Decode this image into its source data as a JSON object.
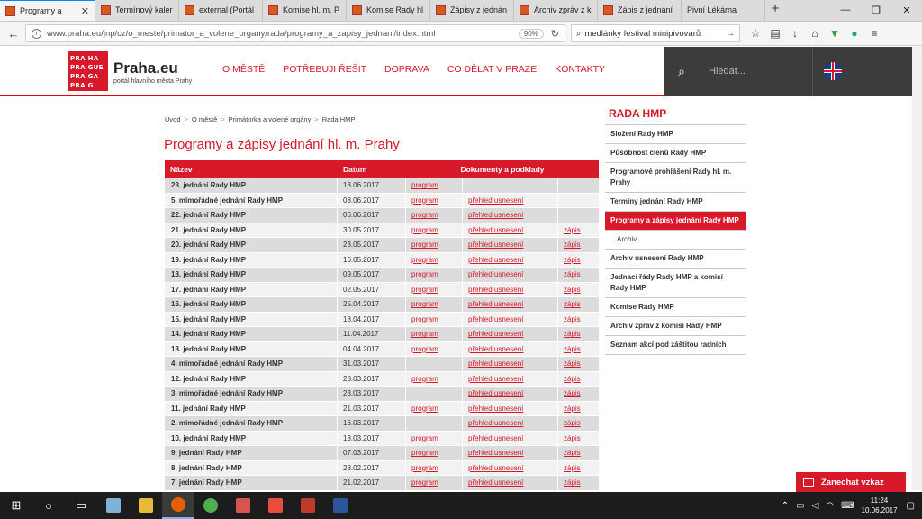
{
  "browser": {
    "tabs": [
      {
        "label": "Programy a",
        "active": true,
        "has_icon": true
      },
      {
        "label": "Termínový kaler",
        "has_icon": true
      },
      {
        "label": "external (Portál",
        "has_icon": true
      },
      {
        "label": "Komise hl. m. P",
        "has_icon": true
      },
      {
        "label": "Komise Rady hl.",
        "has_icon": true
      },
      {
        "label": "Zápisy z jednán",
        "has_icon": true
      },
      {
        "label": "Archiv zpráv z k",
        "has_icon": true
      },
      {
        "label": "Zápis z jednání",
        "has_icon": true
      },
      {
        "label": "Pivní Lékárna",
        "has_icon": false
      }
    ],
    "url": "www.praha.eu/jnp/cz/o_meste/primator_a_volene_organy/rada/programy_a_zapisy_jednani/index.html",
    "zoom": "90%",
    "search_value": "medlánky festival minipivovarů"
  },
  "site": {
    "logo_lines": [
      "PRA HA",
      "PRA GUE",
      "PRA GA",
      "PRA G"
    ],
    "brand_name": "Praha.eu",
    "brand_tagline": "portál hlavního města Prahy",
    "nav": [
      "O MĚSTĚ",
      "POTŘEBUJI ŘEŠIT",
      "DOPRAVA",
      "CO DĚLAT V PRAZE",
      "KONTAKTY"
    ],
    "search_placeholder": "Hledat..."
  },
  "breadcrumb": [
    "Úvod",
    "O městě",
    "Primátorka a volené orgány",
    "Rada HMP"
  ],
  "page_title": "Programy a zápisy jednání hl. m. Prahy",
  "table": {
    "headers": {
      "name": "Název",
      "date": "Datum",
      "docs": "Dokumenty a podklady"
    },
    "rows": [
      {
        "name": "23. jednání Rady HMP",
        "date": "13.06.2017",
        "program": "program",
        "usneseni": "",
        "zapis": ""
      },
      {
        "name": "5. mimořádné jednání Rady HMP",
        "date": "08.06.2017",
        "program": "program",
        "usneseni": "přehled usnesení",
        "zapis": ""
      },
      {
        "name": "22. jednání Rady HMP",
        "date": "06.06.2017",
        "program": "program",
        "usneseni": "přehled usnesení",
        "zapis": ""
      },
      {
        "name": "21. jednání Rady HMP",
        "date": "30.05.2017",
        "program": "program",
        "usneseni": "přehled usnesení",
        "zapis": "zápis"
      },
      {
        "name": "20. jednání Rady HMP",
        "date": "23.05.2017",
        "program": "program",
        "usneseni": "přehled usnesení",
        "zapis": "zápis"
      },
      {
        "name": "19. jednání Rady HMP",
        "date": "16.05.2017",
        "program": "program",
        "usneseni": "přehled usnesení",
        "zapis": "zápis"
      },
      {
        "name": "18. jednání Rady HMP",
        "date": "09.05.2017",
        "program": "program",
        "usneseni": "přehled usnesení",
        "zapis": "zápis"
      },
      {
        "name": "17. jednání Rady HMP",
        "date": "02.05.2017",
        "program": "program",
        "usneseni": "přehled usnesení",
        "zapis": "zápis"
      },
      {
        "name": "16. jednání Rady HMP",
        "date": "25.04.2017",
        "program": "program",
        "usneseni": "přehled usnesení",
        "zapis": "zápis"
      },
      {
        "name": "15. jednání Rady HMP",
        "date": "18.04.2017",
        "program": "program",
        "usneseni": "přehled usnesení",
        "zapis": "zápis"
      },
      {
        "name": "14. jednání Rady HMP",
        "date": "11.04.2017",
        "program": "program",
        "usneseni": "přehled usnesení",
        "zapis": "zápis"
      },
      {
        "name": "13. jednání Rady HMP",
        "date": "04.04.2017",
        "program": "program",
        "usneseni": "přehled usnesení",
        "zapis": "zápis"
      },
      {
        "name": "4. mimořádné jednání Rady HMP",
        "date": "31.03.2017",
        "program": "",
        "usneseni": "přehled usnesení",
        "zapis": "zápis"
      },
      {
        "name": "12. jednání Rady HMP",
        "date": "28.03.2017",
        "program": "program",
        "usneseni": "přehled usnesení",
        "zapis": "zápis"
      },
      {
        "name": "3. mimořádné jednání Rady HMP",
        "date": "23.03.2017",
        "program": "",
        "usneseni": "přehled usnesení",
        "zapis": "zápis"
      },
      {
        "name": "11. jednání Rady HMP",
        "date": "21.03.2017",
        "program": "program",
        "usneseni": "přehled usnesení",
        "zapis": "zápis"
      },
      {
        "name": "2. mimořádné jednání Rady HMP",
        "date": "16.03.2017",
        "program": "",
        "usneseni": "přehled usnesení",
        "zapis": "zápis"
      },
      {
        "name": "10. jednání Rady HMP",
        "date": "13.03.2017",
        "program": "program",
        "usneseni": "přehled usnesení",
        "zapis": "zápis"
      },
      {
        "name": "9. jednání Rady HMP",
        "date": "07.03.2017",
        "program": "program",
        "usneseni": "přehled usnesení",
        "zapis": "zápis"
      },
      {
        "name": "8. jednání Rady HMP",
        "date": "28.02.2017",
        "program": "program",
        "usneseni": "přehled usnesení",
        "zapis": "zápis"
      },
      {
        "name": "7. jednání Rady HMP",
        "date": "21.02.2017",
        "program": "program",
        "usneseni": "přehled usnesení",
        "zapis": "zápis"
      }
    ]
  },
  "sidebar": {
    "title": "RADA HMP",
    "items": [
      {
        "label": "Složení Rady HMP",
        "active": false,
        "sub": false
      },
      {
        "label": "Působnost členů Rady HMP",
        "active": false,
        "sub": false
      },
      {
        "label": "Programové prohlášení Rady hl. m. Prahy",
        "active": false,
        "sub": false
      },
      {
        "label": "Termíny jednání Rady HMP",
        "active": false,
        "sub": false
      },
      {
        "label": "Programy a zápisy jednání Rady HMP",
        "active": true,
        "sub": false
      },
      {
        "label": "Archiv",
        "active": false,
        "sub": true
      },
      {
        "label": "Archiv usnesení Rady HMP",
        "active": false,
        "sub": false
      },
      {
        "label": "Jednací řády Rady HMP a komisí Rady HMP",
        "active": false,
        "sub": false
      },
      {
        "label": "Komise Rady HMP",
        "active": false,
        "sub": false
      },
      {
        "label": "Archiv zpráv z komisí Rady HMP",
        "active": false,
        "sub": false
      },
      {
        "label": "Seznam akcí pod záštitou radních",
        "active": false,
        "sub": false
      }
    ]
  },
  "chat_button": "Zanechat vzkaz",
  "taskbar": {
    "time": "11:24",
    "date": "10.06.2017"
  },
  "colors": {
    "accent": "#d7192a",
    "dark": "#3c3c3c"
  }
}
